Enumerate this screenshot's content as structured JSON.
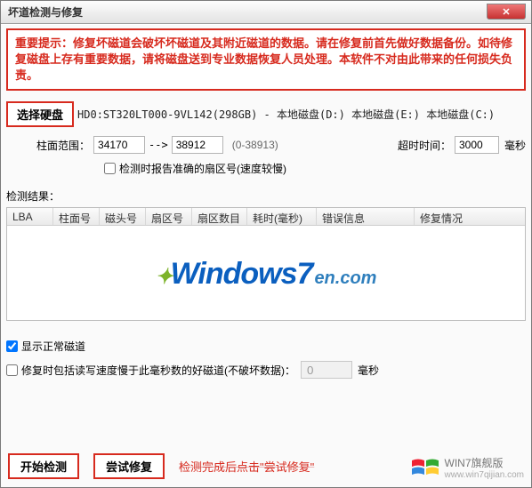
{
  "window": {
    "title": "坏道检测与修复"
  },
  "warning": "重要提示：修复坏磁道会破坏坏磁道及其附近磁道的数据。请在修复前首先做好数据备份。如待修复磁盘上存有重要数据，请将磁盘送到专业数据恢复人员处理。本软件不对由此带来的任何损失负责。",
  "disk": {
    "select_btn": "选择硬盘",
    "string": "HD0:ST320LT000-9VL142(298GB) - 本地磁盘(D:) 本地磁盘(E:) 本地磁盘(C:)"
  },
  "range": {
    "label": "柱面范围：",
    "from": "34170",
    "arrow": "-->",
    "to": "38912",
    "total": "(0-38913)",
    "timeout_label": "超时时间：",
    "timeout_value": "3000",
    "timeout_unit": "毫秒"
  },
  "option_accurate": "检测时报告准确的扇区号(速度较慢)",
  "results_label": "检测结果：",
  "columns": {
    "lba": "LBA",
    "cyl": "柱面号",
    "head": "磁头号",
    "sec": "扇区号",
    "cnt": "扇区数目",
    "time": "耗时(毫秒)",
    "err": "错误信息",
    "fix": "修复情况"
  },
  "logo": {
    "spark": "✦",
    "main": "Windows7",
    "suffix": "en.com"
  },
  "show_normal": "显示正常磁道",
  "slow_opt": {
    "label": "修复时包括读写速度慢于此毫秒数的好磁道(不破坏数据)：",
    "value": "0",
    "unit": "毫秒"
  },
  "footer": {
    "start": "开始检测",
    "repair": "尝试修复",
    "hint": "检测完成后点击\"尝试修复\""
  },
  "brand": "WIN7旗舰版",
  "brand_url": "www.win7qijian.com"
}
